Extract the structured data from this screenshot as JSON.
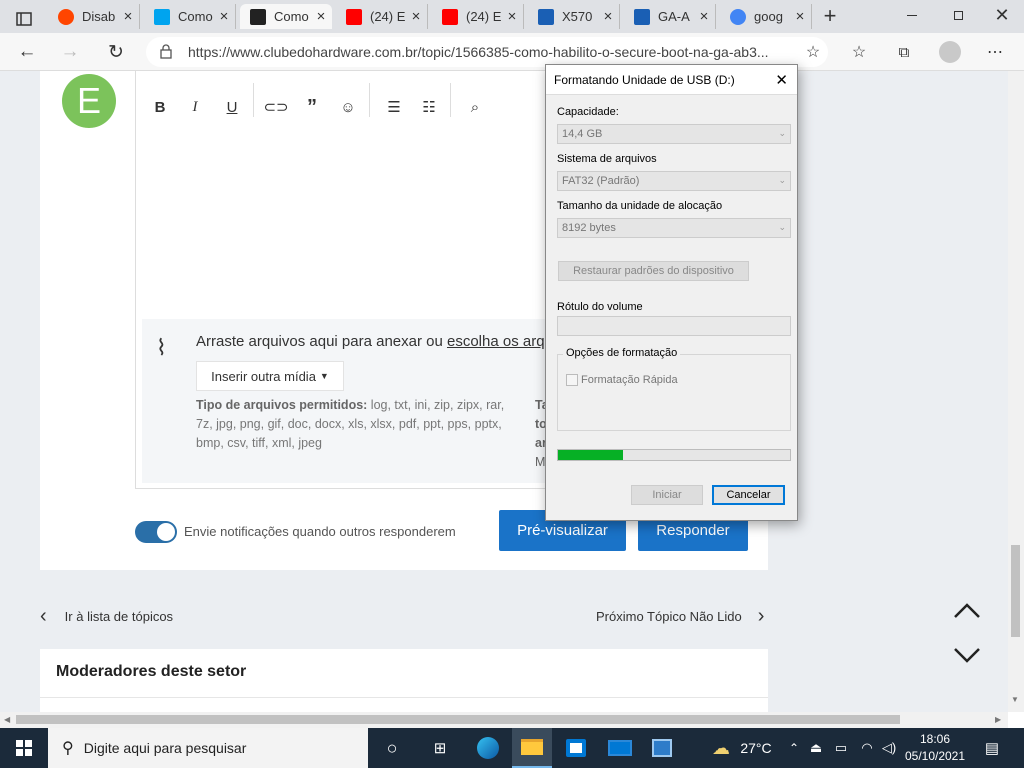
{
  "browser": {
    "tabs": [
      {
        "title": "Disab",
        "icon": "reddit-icon",
        "color": "#ff4500",
        "active": false
      },
      {
        "title": "Como",
        "icon": "windows-icon",
        "color": "#00a4ef",
        "active": false
      },
      {
        "title": "Como",
        "icon": "cdh-icon",
        "color": "#222222",
        "active": true
      },
      {
        "title": "(24) E",
        "icon": "youtube-icon",
        "color": "#ff0000",
        "active": false
      },
      {
        "title": "(24) E",
        "icon": "youtube-icon",
        "color": "#ff0000",
        "active": false
      },
      {
        "title": "X570",
        "icon": "gigabyte-icon",
        "color": "#1a5fb4",
        "active": false
      },
      {
        "title": "GA-A",
        "icon": "gigabyte-icon",
        "color": "#1a5fb4",
        "active": false
      },
      {
        "title": "goog",
        "icon": "google-icon",
        "color": "#4285f4",
        "active": false
      }
    ],
    "url": "https://www.clubedohardware.com.br/topic/1566385-como-habilito-o-secure-boot-na-ga-ab3..."
  },
  "editor": {
    "avatar_letter": "E",
    "avatar_color": "#7cc35b",
    "drop_text": "Arraste arquivos aqui para anexar ou ",
    "drop_link": "escolha os arq",
    "insert_media": "Inserir outra mídia",
    "types_label": "Tipo de arquivos permitidos:",
    "types_line1": " log, txt, ini, zip, zipx, rar,",
    "types_line2": "7z, jpg, png, gif, doc, docx, xls, xlsx, pdf, ppt, pps, pptx,",
    "types_line3": "bmp, csv, tiff, xml, jpeg",
    "partial_right": [
      "Ta",
      "to",
      "ar",
      "M"
    ],
    "notify_label": "Envie notificações quando outros responderem",
    "preview_btn": "Pré-visualizar",
    "reply_btn": "Responder"
  },
  "nav": {
    "back_label": "Ir à lista de tópicos",
    "next_label": "Próximo Tópico Não Lido"
  },
  "moderators": {
    "title": "Moderadores deste setor"
  },
  "dialog": {
    "title": "Formatando Unidade de USB (D:)",
    "capacity_label": "Capacidade:",
    "capacity_value": "14,4 GB",
    "fs_label": "Sistema de arquivos",
    "fs_value": "FAT32 (Padrão)",
    "alloc_label": "Tamanho da unidade de alocação",
    "alloc_value": "8192 bytes",
    "restore_btn": "Restaurar padrões do dispositivo",
    "volume_label": "Rótulo do volume",
    "volume_value": "",
    "options_label": "Opções de formatação",
    "quick_label": "Formatação Rápida",
    "progress": 0.28,
    "start_btn": "Iniciar",
    "cancel_btn": "Cancelar"
  },
  "taskbar": {
    "search_placeholder": "Digite aqui para pesquisar",
    "weather": "27°C",
    "time": "18:06",
    "date": "05/10/2021"
  }
}
